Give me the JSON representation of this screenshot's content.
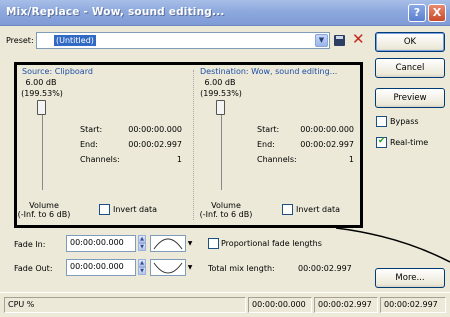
{
  "window": {
    "title": "Mix/Replace - Wow, sound editing...",
    "help_label": "?",
    "close_label": "X"
  },
  "preset": {
    "label": "Preset:",
    "value": "(Untitled)"
  },
  "buttons": {
    "ok": "OK",
    "cancel": "Cancel",
    "preview": "Preview",
    "more": "More..."
  },
  "options": {
    "bypass": {
      "label": "Bypass",
      "checked": false
    },
    "realtime": {
      "label": "Real-time",
      "checked": true
    }
  },
  "source": {
    "title": "Source: Clipboard",
    "db": "6.00 dB",
    "percent": "(199.53%)",
    "start_label": "Start:",
    "start_value": "00:00:00.000",
    "end_label": "End:",
    "end_value": "00:00:02.997",
    "channels_label": "Channels:",
    "channels_value": "1",
    "volume_label": "Volume",
    "volume_range": "(-Inf. to 6 dB)",
    "invert_label": "Invert data",
    "volume_db": 6.0
  },
  "destination": {
    "title": "Destination: Wow, sound editing...",
    "db": "6.00 dB",
    "percent": "(199.53%)",
    "start_label": "Start:",
    "start_value": "00:00:00.000",
    "end_label": "End:",
    "end_value": "00:00:02.997",
    "channels_label": "Channels:",
    "channels_value": "1",
    "volume_label": "Volume",
    "volume_range": "(-Inf. to 6 dB)",
    "invert_label": "Invert data",
    "volume_db": 6.0
  },
  "fades": {
    "fade_in_label": "Fade In:",
    "fade_in_value": "00:00:00.000",
    "fade_out_label": "Fade Out:",
    "fade_out_value": "00:00:00.000",
    "proportional_label": "Proportional fade lengths",
    "total_label": "Total mix length:",
    "total_value": "00:00:02.997"
  },
  "statusbar": {
    "cpu": "CPU %",
    "cell1": "00:00:00.000",
    "cell2": "00:00:02.997",
    "cell3": "00:00:02.997"
  },
  "colors": {
    "title_bar": "#8ea9dd",
    "highlight": "#316ac5",
    "panel_title": "#1e4fa8",
    "annotation_outline": "#000000"
  }
}
